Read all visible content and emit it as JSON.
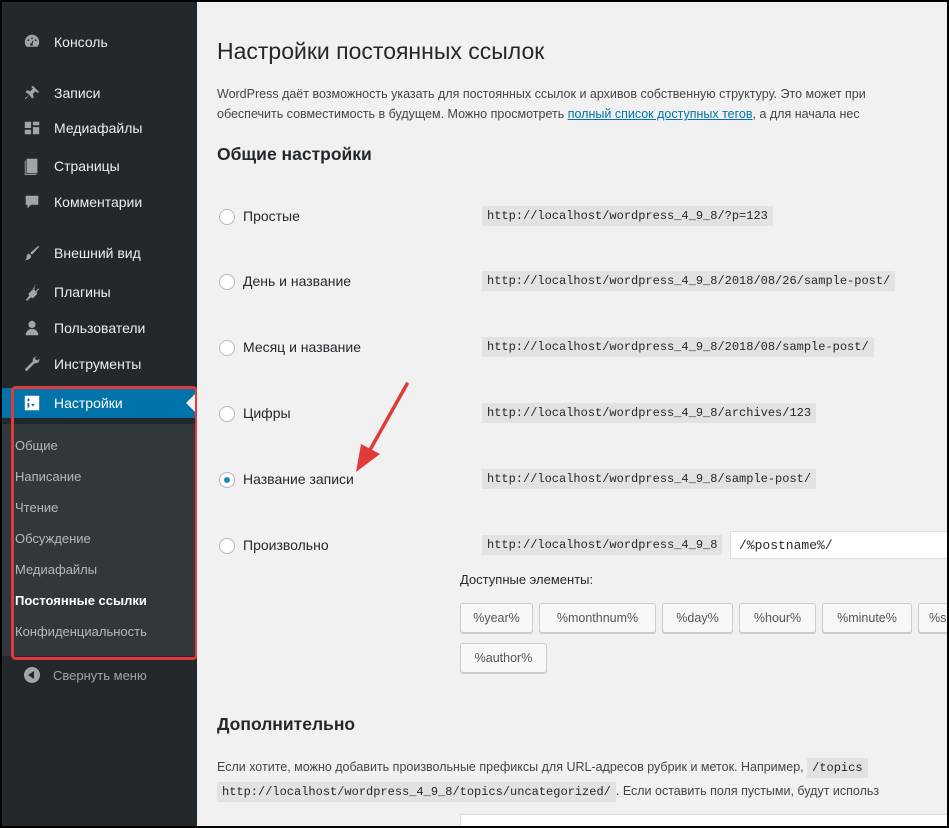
{
  "sidebar": {
    "items": [
      {
        "label": "Консоль",
        "icon": "dashboard-icon"
      },
      {
        "label": "Записи",
        "icon": "pin-icon"
      },
      {
        "label": "Медиафайлы",
        "icon": "media-icon"
      },
      {
        "label": "Страницы",
        "icon": "page-icon"
      },
      {
        "label": "Комментарии",
        "icon": "comment-icon"
      },
      {
        "label": "Внешний вид",
        "icon": "brush-icon"
      },
      {
        "label": "Плагины",
        "icon": "plugin-icon"
      },
      {
        "label": "Пользователи",
        "icon": "user-icon"
      },
      {
        "label": "Инструменты",
        "icon": "wrench-icon"
      },
      {
        "label": "Настройки",
        "icon": "settings-icon"
      }
    ],
    "submenu": [
      "Общие",
      "Написание",
      "Чтение",
      "Обсуждение",
      "Медиафайлы",
      "Постоянные ссылки",
      "Конфиденциальность"
    ],
    "collapse_label": "Свернуть меню"
  },
  "main": {
    "title": "Настройки постоянных ссылок",
    "intro_line1": "WordPress даёт возможность указать для постоянных ссылок и архивов собственную структуру. Это может при",
    "intro_line2_before": "обеспечить совместимость в будущем. Можно просмотреть ",
    "intro_link": "полный список доступных тегов",
    "intro_line2_after": ", а для начала нес",
    "common_heading": "Общие настройки",
    "options": [
      {
        "label": "Простые",
        "url": "http://localhost/wordpress_4_9_8/?p=123",
        "checked": false
      },
      {
        "label": "День и название",
        "url": "http://localhost/wordpress_4_9_8/2018/08/26/sample-post/",
        "checked": false
      },
      {
        "label": "Месяц и название",
        "url": "http://localhost/wordpress_4_9_8/2018/08/sample-post/",
        "checked": false
      },
      {
        "label": "Цифры",
        "url": "http://localhost/wordpress_4_9_8/archives/123",
        "checked": false
      },
      {
        "label": "Название записи",
        "url": "http://localhost/wordpress_4_9_8/sample-post/",
        "checked": true
      },
      {
        "label": "Произвольно",
        "url": "http://localhost/wordpress_4_9_8",
        "checked": false
      }
    ],
    "custom_value": "/%postname%/",
    "available_label": "Доступные элементы:",
    "tags": [
      "%year%",
      "%monthnum%",
      "%day%",
      "%hour%",
      "%minute%",
      "%s",
      "%author%"
    ],
    "extra_heading": "Дополнительно",
    "extra_line1": "Если хотите, можно добавить произвольные префиксы для URL-адресов рубрик и меток. Например,",
    "extra_code1": "/topics",
    "extra_code2": "http://localhost/wordpress_4_9_8/topics/uncategorized/",
    "extra_line2_after": ". Если оставить поля пустыми, будут использ"
  },
  "colors": {
    "sidebar_bg": "#23282d",
    "submenu_bg": "#32373c",
    "accent": "#0073aa",
    "highlight": "#e03a3a",
    "link": "#0073aa"
  }
}
